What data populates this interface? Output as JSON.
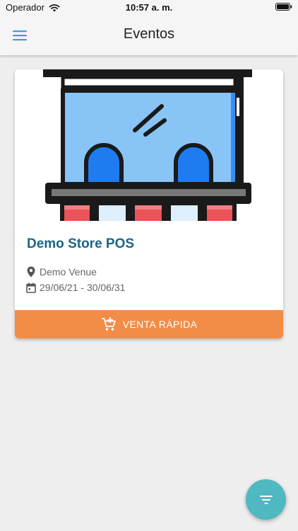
{
  "status_bar": {
    "carrier": "Operador",
    "time": "10:57 a. m."
  },
  "app_bar": {
    "title": "Eventos",
    "menu_icon": "menu-icon"
  },
  "event_card": {
    "image_icon": "store-illustration",
    "title": "Demo Store POS",
    "venue": "Demo Venue",
    "dates": "29/06/21 - 30/06/31",
    "venue_icon": "location-pin-icon",
    "date_icon": "calendar-icon",
    "action_label": "VENTA RÁPIDA",
    "action_icon": "cart-plus-icon"
  },
  "fab": {
    "icon": "filter-icon"
  },
  "colors": {
    "accent": "#4fb8c1",
    "title": "#1a6685",
    "action": "#f28c46",
    "background": "#eeeeee"
  }
}
